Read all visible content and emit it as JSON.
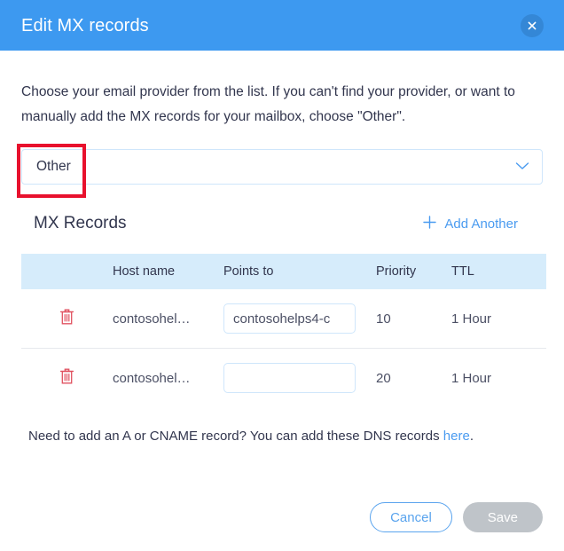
{
  "header": {
    "title": "Edit MX records",
    "close_icon": "close-icon"
  },
  "body": {
    "intro_text": "Choose your email provider from the list. If you can't find your provider, or want to manually add the MX records for your mailbox, choose \"Other\".",
    "provider_select": {
      "value": "Other",
      "chevron_icon": "chevron-down-icon"
    },
    "records": {
      "title": "MX Records",
      "add_another_label": "Add Another",
      "plus_icon": "plus-icon",
      "columns": [
        "",
        "Host name",
        "Points to",
        "Priority",
        "TTL"
      ],
      "rows": [
        {
          "delete_icon": "trash-icon",
          "host_name": "contosohel…",
          "points_to": "contosohelps4-c",
          "points_to_placeholder": "",
          "priority": "10",
          "ttl": "1 Hour"
        },
        {
          "delete_icon": "trash-icon",
          "host_name": "contosohel…",
          "points_to": "",
          "points_to_placeholder": "",
          "priority": "20",
          "ttl": "1 Hour"
        }
      ]
    },
    "dns_note": {
      "text_before": "Need to add an A or CNAME record? You can add these DNS records ",
      "link_label": "here",
      "text_after": "."
    }
  },
  "footer": {
    "cancel_label": "Cancel",
    "save_label": "Save"
  },
  "colors": {
    "header_blue": "#3d99f0",
    "link_blue": "#4a9bf0",
    "table_header_blue": "#d6ecfb",
    "trash_red": "#e05260",
    "highlight_red": "#e8112d",
    "save_disabled_gray": "#bfc4c9"
  }
}
